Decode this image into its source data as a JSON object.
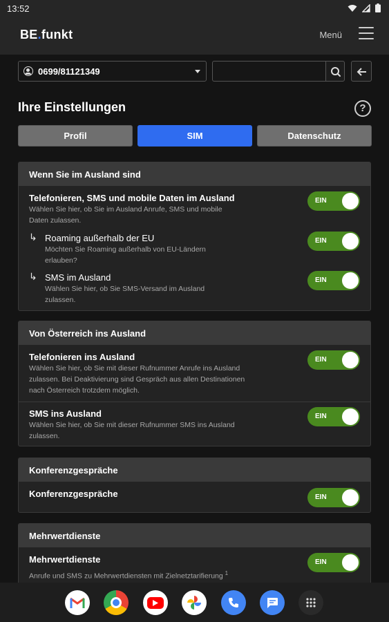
{
  "status": {
    "time": "13:52"
  },
  "header": {
    "logo_left": "BE",
    "logo_dot": ".",
    "logo_right": "funkt",
    "menu_label": "Menü"
  },
  "controls": {
    "phone_number": "0699/81121349",
    "search_placeholder": ""
  },
  "page": {
    "title": "Ihre Einstellungen",
    "help_symbol": "?"
  },
  "tabs": [
    {
      "label": "Profil",
      "active": false
    },
    {
      "label": "SIM",
      "active": true
    },
    {
      "label": "Datenschutz",
      "active": false
    }
  ],
  "sections": {
    "abroad": {
      "title": "Wenn Sie im Ausland sind",
      "rows": [
        {
          "title": "Telefonieren, SMS und mobile Daten im Ausland",
          "desc": "Wählen Sie hier, ob Sie im Ausland Anrufe, SMS und mobile Daten zulassen.",
          "toggle": "EIN"
        },
        {
          "title": "Roaming außerhalb der EU",
          "desc": "Möchten Sie Roaming außerhalb von EU-Ländern erlauben?",
          "toggle": "EIN"
        },
        {
          "title": "SMS im Ausland",
          "desc": "Wählen Sie hier, ob Sie SMS-Versand im Ausland zulassen.",
          "toggle": "EIN"
        }
      ]
    },
    "to_abroad": {
      "title": "Von Österreich ins Ausland",
      "rows": [
        {
          "title": "Telefonieren ins Ausland",
          "desc": "Wählen Sie hier, ob Sie mit dieser Rufnummer Anrufe ins Ausland zulassen. Bei Deaktivierung sind Gespräch aus allen Destinationen nach Österreich trotzdem möglich.",
          "toggle": "EIN"
        },
        {
          "title": "SMS ins Ausland",
          "desc": "Wählen Sie hier, ob Sie mit dieser Rufnummer SMS ins Ausland zulassen.",
          "toggle": "EIN"
        }
      ]
    },
    "conference": {
      "title": "Konferenzgespräche",
      "rows": [
        {
          "title": "Konferenzgespräche",
          "toggle": "EIN"
        }
      ]
    },
    "premium": {
      "title": "Mehrwertdienste",
      "rows": [
        {
          "title": "Mehrwertdienste",
          "desc": "Anrufe und SMS zu Mehrwertdiensten mit Zielnetztarifierung",
          "sup": "1",
          "toggle": "EIN"
        }
      ]
    }
  },
  "dock": [
    "gmail-icon",
    "chrome-icon",
    "youtube-icon",
    "photos-icon",
    "phone-icon",
    "messages-icon",
    "app-drawer-icon"
  ],
  "colors": {
    "accent": "#2f6cf0",
    "toggle_on": "#4a8a1f",
    "tab_inactive": "#6f6f6f",
    "section_header": "#3a3a3a"
  }
}
